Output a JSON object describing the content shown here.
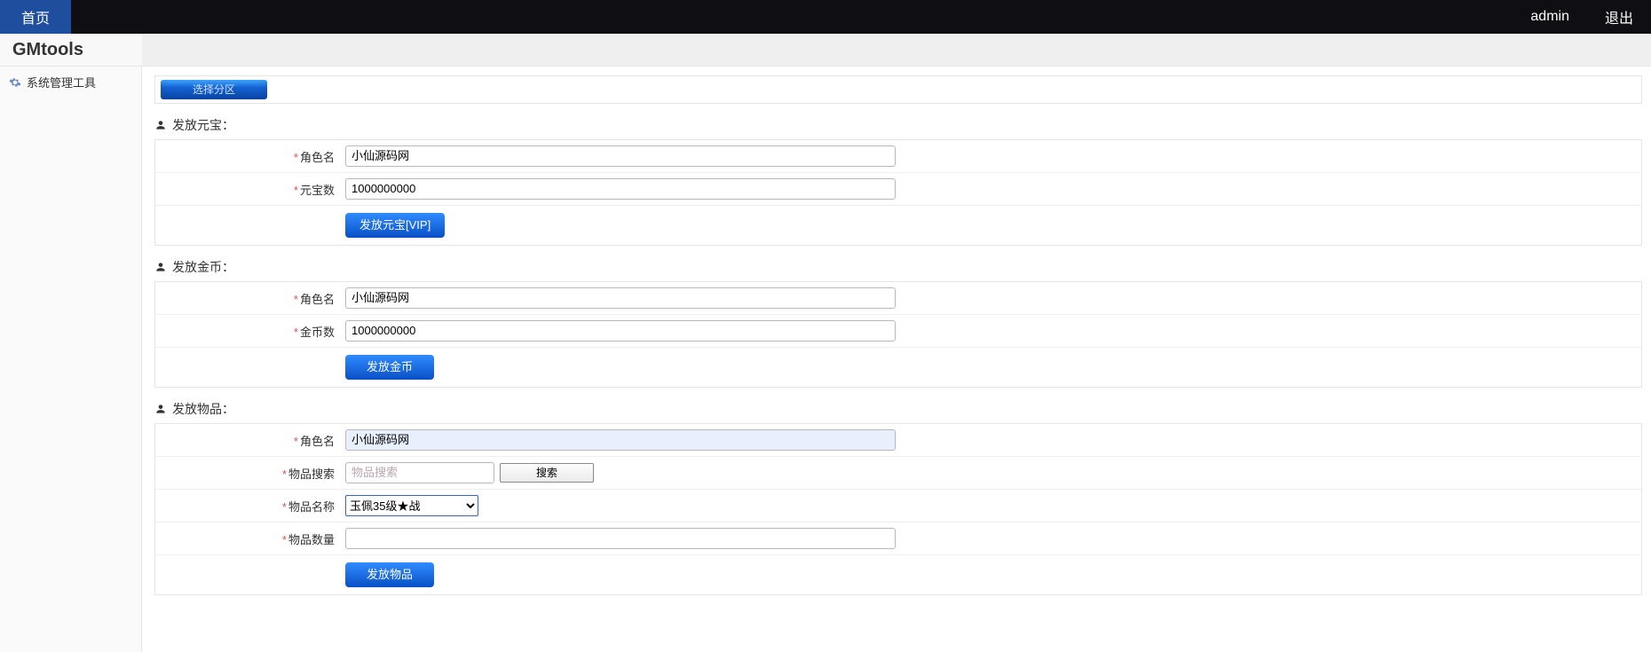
{
  "topbar": {
    "home_label": "首页",
    "admin_label": "admin",
    "logout_label": "退出"
  },
  "brand": {
    "title": "GMtools"
  },
  "sidebar": {
    "item0": {
      "label": "系统管理工具"
    }
  },
  "zone": {
    "pill_label": "选择分区"
  },
  "sec_yuanbao": {
    "title": "发放元宝：",
    "role_label": "角色名",
    "role_value": "小仙源码网",
    "amount_label": "元宝数",
    "amount_value": "1000000000",
    "button_label": "发放元宝[VIP]"
  },
  "sec_gold": {
    "title": "发放金币：",
    "role_label": "角色名",
    "role_value": "小仙源码网",
    "amount_label": "金币数",
    "amount_value": "1000000000",
    "button_label": "发放金币"
  },
  "sec_item": {
    "title": "发放物品：",
    "role_label": "角色名",
    "role_value": "小仙源码网",
    "search_label": "物品搜索",
    "search_placeholder": "物品搜索",
    "search_button_label": "搜索",
    "name_label": "物品名称",
    "name_selected": "玉佩35级★战",
    "qty_label": "物品数量",
    "qty_value": "",
    "button_label": "发放物品"
  }
}
